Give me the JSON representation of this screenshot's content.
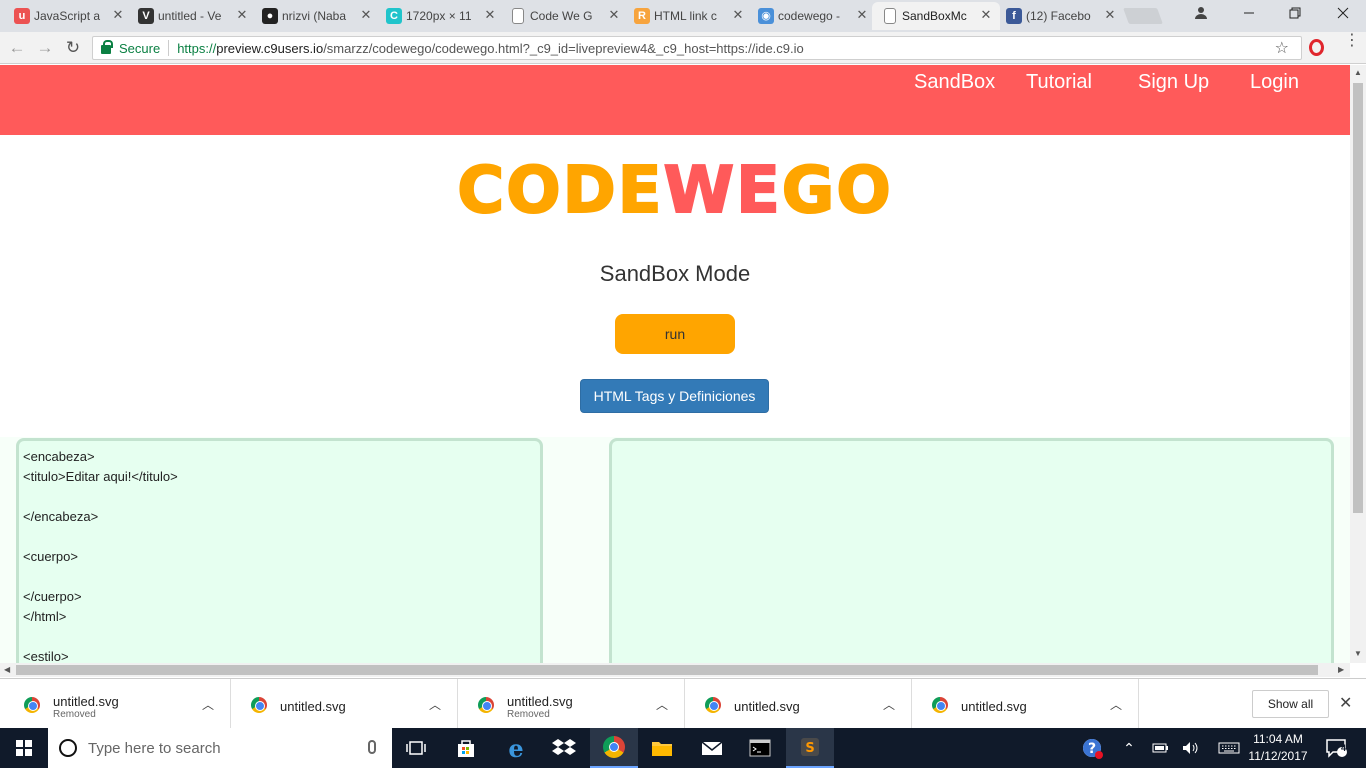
{
  "browser": {
    "tabs": [
      {
        "title": "JavaScript a",
        "favicon": "udemy-icon",
        "color": "#ec5252",
        "glyph": "u"
      },
      {
        "title": "untitled - Ve",
        "favicon": "vectr-icon",
        "color": "#333333",
        "glyph": "V"
      },
      {
        "title": "nrizvi (Naba",
        "favicon": "github-icon",
        "color": "#222222",
        "glyph": "●"
      },
      {
        "title": "1720px × 11",
        "favicon": "canva-icon",
        "color": "#20c4cb",
        "glyph": "C"
      },
      {
        "title": "Code We G",
        "favicon": "page-icon",
        "color": "#ffffff",
        "glyph": ""
      },
      {
        "title": "HTML link c",
        "favicon": "r-icon",
        "color": "#f7a43e",
        "glyph": "R"
      },
      {
        "title": "codewego -",
        "favicon": "preview-icon",
        "color": "#4a90d9",
        "glyph": "◉"
      },
      {
        "title": "SandBoxMc",
        "favicon": "page-icon",
        "color": "#ffffff",
        "glyph": ""
      },
      {
        "title": "(12) Facebo",
        "favicon": "facebook-icon",
        "color": "#3b5998",
        "glyph": "f"
      }
    ],
    "close_glyph": "✕",
    "back_glyph": "←",
    "forward_glyph": "→",
    "reload_glyph": "↻",
    "secure_label": "Secure",
    "url_scheme": "https://",
    "url_domain": "preview.c9users.io",
    "url_path": "/smarzz/codewego/codewego.html?_c9_id=livepreview4&_c9_host=https://ide.c9.io",
    "star_glyph": "☆",
    "menu_glyph": "⋮"
  },
  "page": {
    "nav": [
      "SandBox",
      "Tutorial",
      "Sign Up",
      "Login"
    ],
    "logo": {
      "part1": "CODE",
      "part2": "WE",
      "part3": "GO"
    },
    "mode_title": "SandBox Mode",
    "run_label": "run",
    "tags_button_label": "HTML Tags y Definiciones",
    "code": "<encabeza>\n<titulo>Editar aqui!</titulo>\n\n</encabeza>\n\n<cuerpo>\n\n</cuerpo>\n</html>\n\n<estilo>",
    "colors": {
      "brand": "#ff5a5a",
      "accent": "#ffa500",
      "primary": "#337ab7",
      "editor_bg": "#e6fff0"
    }
  },
  "downloads": {
    "items": [
      {
        "name": "untitled.svg",
        "status": "Removed"
      },
      {
        "name": "untitled.svg",
        "status": ""
      },
      {
        "name": "untitled.svg",
        "status": "Removed"
      },
      {
        "name": "untitled.svg",
        "status": ""
      },
      {
        "name": "untitled.svg",
        "status": ""
      }
    ],
    "chevron_glyph": "︿",
    "show_all_label": "Show all",
    "close_glyph": "✕"
  },
  "taskbar": {
    "search_placeholder": "Type here to search",
    "time": "11:04 AM",
    "date": "11/12/2017",
    "notification_count": "4"
  }
}
